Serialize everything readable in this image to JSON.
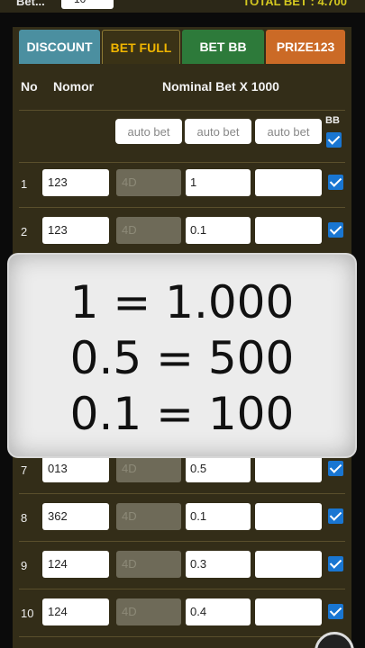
{
  "topbar": {
    "label": "Bet...",
    "input_value": "10",
    "total_label": "TOTAL BET : 4.700"
  },
  "tabs": [
    {
      "label": "DISCOUNT"
    },
    {
      "label": "BET FULL"
    },
    {
      "label": "BET BB"
    },
    {
      "label": "PRIZE123"
    }
  ],
  "header": {
    "no": "No",
    "nomor": "Nomor",
    "nominal": "Nominal Bet X 1000"
  },
  "auto_row": {
    "auto_bet_label": "auto bet",
    "bb_label": "BB"
  },
  "rows": [
    {
      "no": "1",
      "nomor": "123",
      "placeholder": "4D",
      "bet": "1"
    },
    {
      "no": "2",
      "nomor": "123",
      "placeholder": "4D",
      "bet": "0.1"
    },
    {
      "no": "7",
      "nomor": "013",
      "placeholder": "4D",
      "bet": "0.5"
    },
    {
      "no": "8",
      "nomor": "362",
      "placeholder": "4D",
      "bet": "0.1"
    },
    {
      "no": "9",
      "nomor": "124",
      "placeholder": "4D",
      "bet": "0.3"
    },
    {
      "no": "10",
      "nomor": "124",
      "placeholder": "4D",
      "bet": "0.4"
    }
  ],
  "overlay": {
    "lines": [
      "1 = 1.000",
      "0.5 = 500",
      "0.1 = 100"
    ]
  },
  "colors": {
    "discount": "#4b8fa0",
    "bet_full": "#f0b500",
    "bet_bb": "#2d7a3a",
    "prize": "#cb6a26",
    "panel": "#332d18",
    "checkbox": "#1976d2"
  }
}
